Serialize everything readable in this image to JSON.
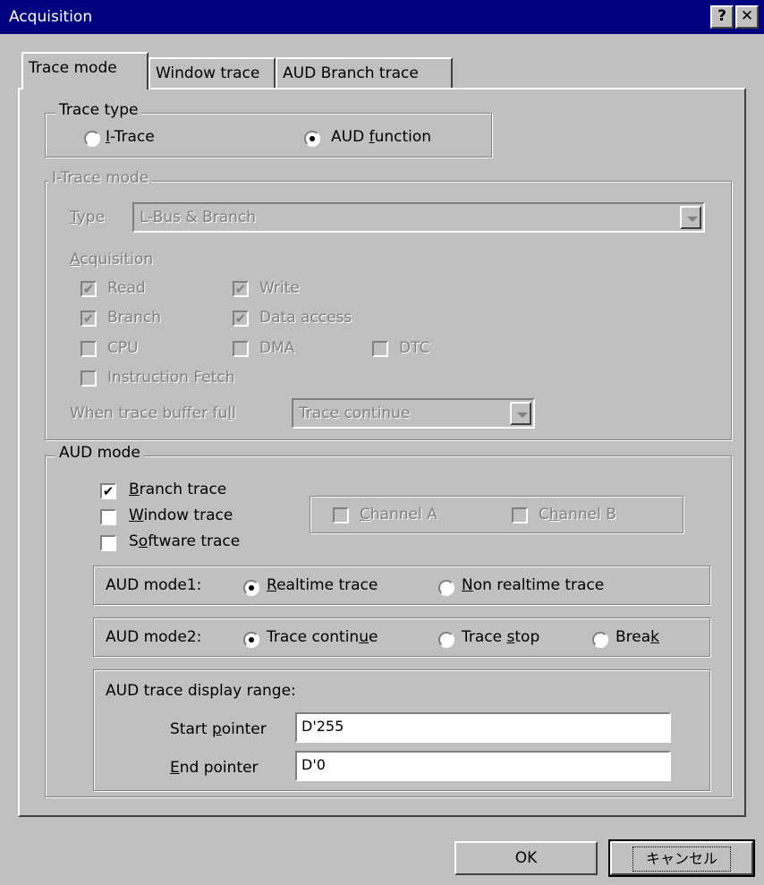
{
  "window": {
    "title": "Acquisition",
    "help_label": "?",
    "close_label": "✕"
  },
  "tabs": [
    "Trace mode",
    "Window trace",
    "AUD Branch trace"
  ],
  "trace_type": {
    "legend": "Trace type",
    "itrace_label_pre": "",
    "itrace_label_u": "I",
    "itrace_label_post": "-Trace",
    "aud_label_pre": "AUD ",
    "aud_label_u": "f",
    "aud_label_post": "unction",
    "selected": "AUD function"
  },
  "itrace_mode": {
    "legend": "I-Trace mode",
    "type_label_u": "T",
    "type_label_post": "ype",
    "type_value": "L-Bus & Branch",
    "acq_label_u": "A",
    "acq_label_post": "cquisition",
    "read": "Read",
    "write": "Write",
    "branch": "Branch",
    "data_access": "Data access",
    "cpu": "CPU",
    "dma": "DMA",
    "dtc": "DTC",
    "instruction_fetch": "Instruction Fetch",
    "buffer_label_pre": "When trace buffer fu",
    "buffer_label_u": "l",
    "buffer_label_post": "l",
    "buffer_value": "Trace continue",
    "checked": {
      "read": true,
      "write": true,
      "branch": true,
      "data_access": true,
      "cpu": false,
      "dma": false,
      "dtc": false,
      "instruction_fetch": false
    }
  },
  "aud_mode": {
    "legend": "AUD mode",
    "branch_trace_u": "B",
    "branch_trace_post": "ranch trace",
    "window_trace_u": "W",
    "window_trace_post": "indow trace",
    "software_trace_pre": "S",
    "software_trace_u": "o",
    "software_trace_post": "ftware trace",
    "channel_a_u": "C",
    "channel_a_post": "hannel A",
    "channel_b_pre": "C",
    "channel_b_u": "h",
    "channel_b_post": "annel B",
    "checked": {
      "branch_trace": true,
      "window_trace": false,
      "software_trace": false,
      "channel_a": false,
      "channel_b": false
    },
    "mode1_label": "AUD mode1:",
    "realtime_u": "R",
    "realtime_post": "ealtime trace",
    "nonrealtime_u": "N",
    "nonrealtime_post": "on realtime trace",
    "mode1_selected": "Realtime trace",
    "mode2_label": "AUD mode2:",
    "continue_pre": "Trace contin",
    "continue_u": "u",
    "continue_post": "e",
    "stop_pre": "Trace ",
    "stop_u": "s",
    "stop_post": "top",
    "break_pre": "Brea",
    "break_u": "k",
    "break_post": "",
    "mode2_selected": "Trace continue",
    "range_label": "AUD trace display range:",
    "start_pre": "Start ",
    "start_u": "p",
    "start_post": "ointer",
    "start_value": "D'255",
    "end_u": "E",
    "end_post": "nd pointer",
    "end_value": "D'0"
  },
  "buttons": {
    "ok": "OK",
    "cancel": "キャンセル"
  }
}
